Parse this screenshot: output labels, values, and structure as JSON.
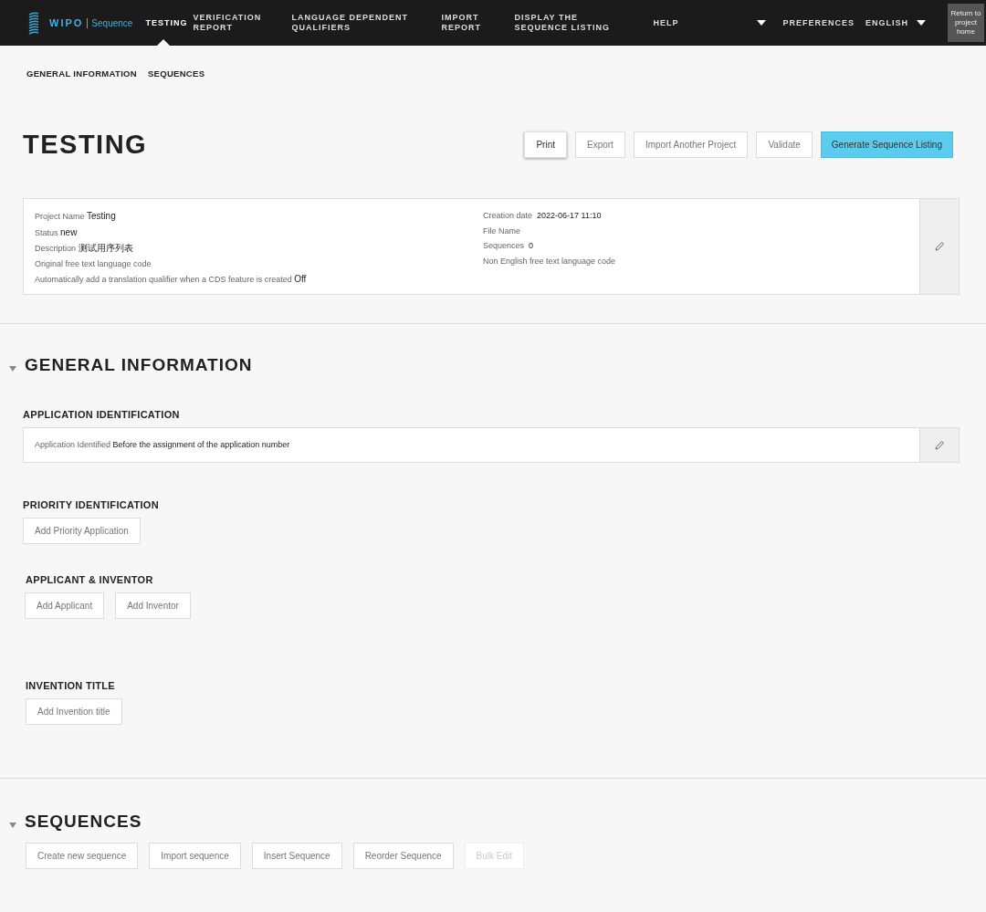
{
  "header": {
    "logo": {
      "brand": "WIPO",
      "product": "Sequence"
    },
    "nav": [
      {
        "label": "TESTING",
        "selected": true
      },
      {
        "label": "VERIFICATION REPORT",
        "selected": false
      },
      {
        "label": "LANGUAGE DEPENDENT QUALIFIERS",
        "selected": false
      },
      {
        "label": "IMPORT REPORT",
        "selected": false
      },
      {
        "label": "DISPLAY THE SEQUENCE LISTING",
        "selected": false
      },
      {
        "label": "HELP",
        "selected": false
      }
    ],
    "preferences": "PREFERENCES",
    "language": "ENGLISH",
    "return_button": "Return to project home"
  },
  "subnav": [
    "GENERAL INFORMATION",
    "SEQUENCES"
  ],
  "page_title": "TESTING",
  "actions": [
    {
      "label": "Print",
      "kind": "raised"
    },
    {
      "label": "Export",
      "kind": "plain"
    },
    {
      "label": "Import Another Project",
      "kind": "plain"
    },
    {
      "label": "Validate",
      "kind": "plain"
    },
    {
      "label": "Generate Sequence Listing",
      "kind": "primary"
    }
  ],
  "project_info": {
    "left": [
      {
        "label": "Project Name",
        "value": "Testing"
      },
      {
        "label": "Status",
        "value": "new"
      },
      {
        "label": "Description",
        "value": "测试用序列表"
      },
      {
        "label": "Original free text language code"
      },
      {
        "label": "Automatically add a translation qualifier when a CDS feature is created",
        "value": "Off"
      }
    ],
    "right": [
      {
        "label": "Creation date",
        "value": "2022-06-17 11:10"
      },
      {
        "label": "File Name"
      },
      {
        "label": "Sequences",
        "value": "0"
      },
      {
        "label": "Non English free text language code"
      }
    ]
  },
  "general_information": {
    "title": "GENERAL INFORMATION",
    "expanded": true,
    "sections": [
      {
        "title": "APPLICATION IDENTIFICATION",
        "kind": "card",
        "fields": [
          {
            "label": "Application Identified",
            "value": "Before the assignment of the application number"
          }
        ]
      },
      {
        "title": "PRIORITY IDENTIFICATION",
        "kind": "buttons",
        "buttons": [
          "Add Priority Application"
        ]
      },
      {
        "title": "APPLICANT & INVENTOR",
        "kind": "buttons",
        "buttons": [
          "Add Applicant",
          "Add Inventor"
        ]
      },
      {
        "title": "INVENTION TITLE",
        "kind": "buttons",
        "buttons": [
          "Add Invention title"
        ]
      }
    ]
  },
  "sequences": {
    "title": "SEQUENCES",
    "expanded": true,
    "buttons": [
      {
        "label": "Create new sequence",
        "disabled": false
      },
      {
        "label": "Import sequence",
        "disabled": false
      },
      {
        "label": "Insert Sequence",
        "disabled": false
      },
      {
        "label": "Reorder Sequence",
        "disabled": false
      },
      {
        "label": "Bulk Edit",
        "disabled": true
      }
    ]
  }
}
